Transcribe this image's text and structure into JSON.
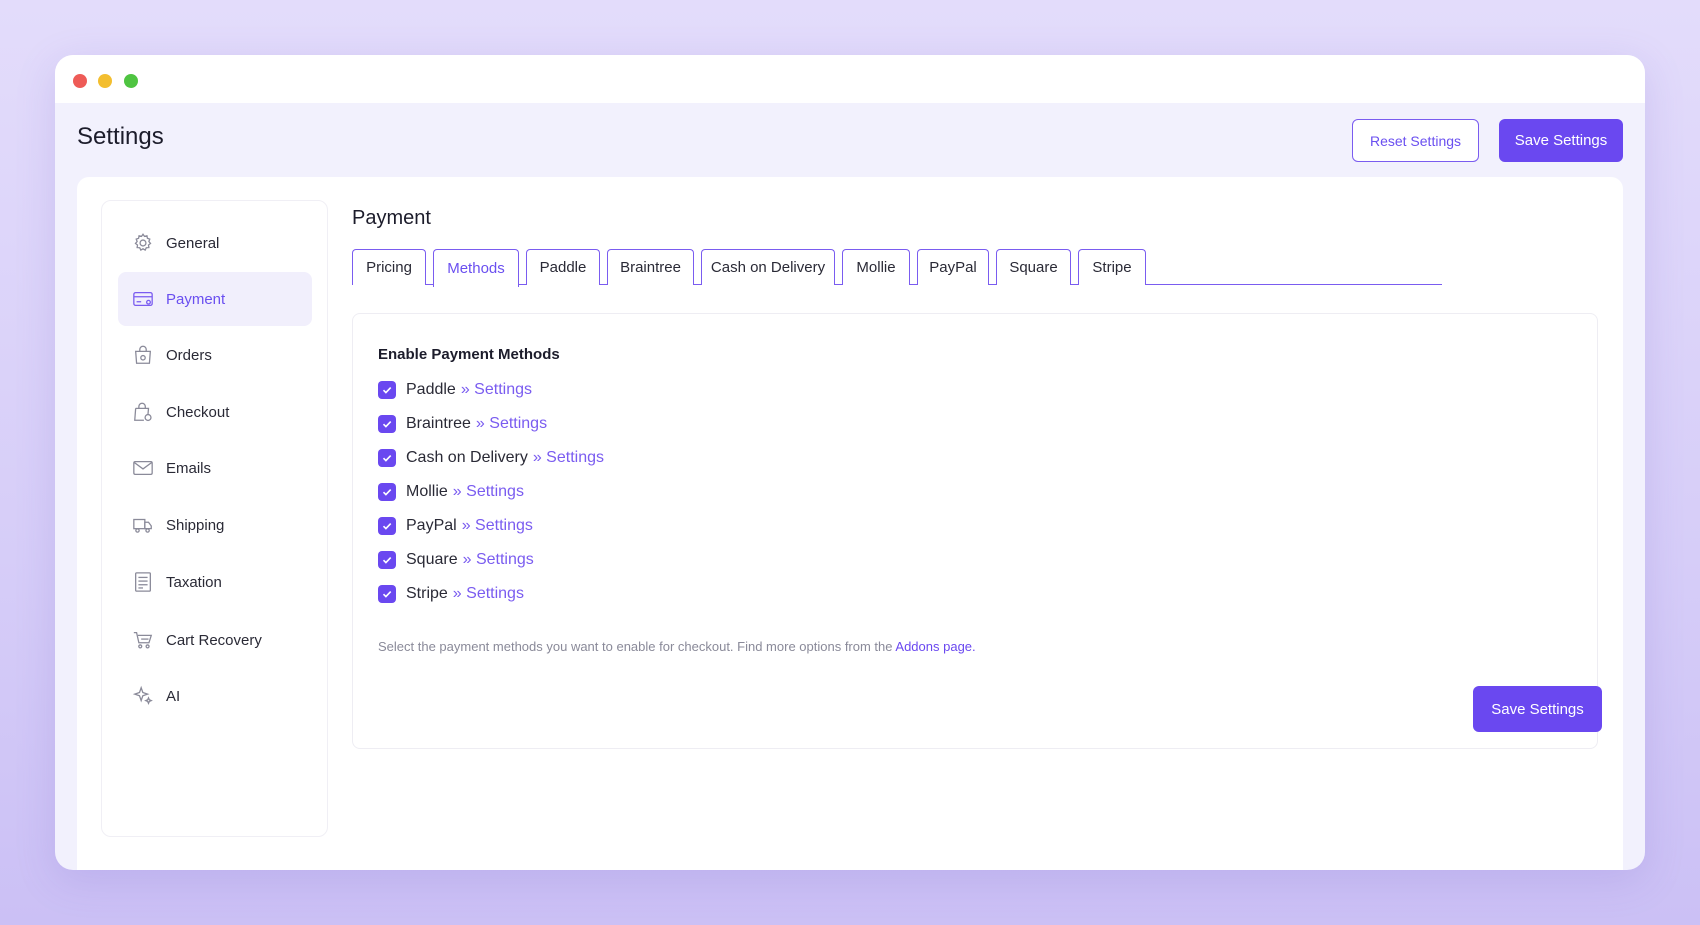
{
  "header": {
    "title": "Settings",
    "reset_label": "Reset Settings",
    "save_label": "Save Settings"
  },
  "sidebar": {
    "items": [
      {
        "label": "General",
        "icon": "gear-icon"
      },
      {
        "label": "Payment",
        "icon": "credit-card-icon",
        "active": true
      },
      {
        "label": "Orders",
        "icon": "shopping-bag-icon"
      },
      {
        "label": "Checkout",
        "icon": "bag-lock-icon"
      },
      {
        "label": "Emails",
        "icon": "envelope-icon"
      },
      {
        "label": "Shipping",
        "icon": "truck-icon"
      },
      {
        "label": "Taxation",
        "icon": "receipt-icon"
      },
      {
        "label": "Cart Recovery",
        "icon": "cart-icon"
      },
      {
        "label": "AI",
        "icon": "sparkle-icon"
      }
    ]
  },
  "main": {
    "title": "Payment",
    "tabs": [
      {
        "label": "Pricing"
      },
      {
        "label": "Methods",
        "active": true
      },
      {
        "label": "Paddle"
      },
      {
        "label": "Braintree"
      },
      {
        "label": "Cash on Delivery"
      },
      {
        "label": "Mollie"
      },
      {
        "label": "PayPal"
      },
      {
        "label": "Square"
      },
      {
        "label": "Stripe"
      }
    ],
    "card": {
      "title": "Enable Payment Methods",
      "link_text": "» Settings",
      "methods": [
        {
          "name": "Paddle",
          "checked": true
        },
        {
          "name": "Braintree",
          "checked": true
        },
        {
          "name": "Cash on Delivery",
          "checked": true
        },
        {
          "name": "Mollie",
          "checked": true
        },
        {
          "name": "PayPal",
          "checked": true
        },
        {
          "name": "Square",
          "checked": true
        },
        {
          "name": "Stripe",
          "checked": true
        }
      ],
      "help_text": "Select the payment methods you want to enable for checkout. Find more options from the ",
      "help_link": "Addons page.",
      "save_label": "Save Settings"
    }
  },
  "colors": {
    "accent": "#6a48f0",
    "background": "#d9d1f9"
  }
}
